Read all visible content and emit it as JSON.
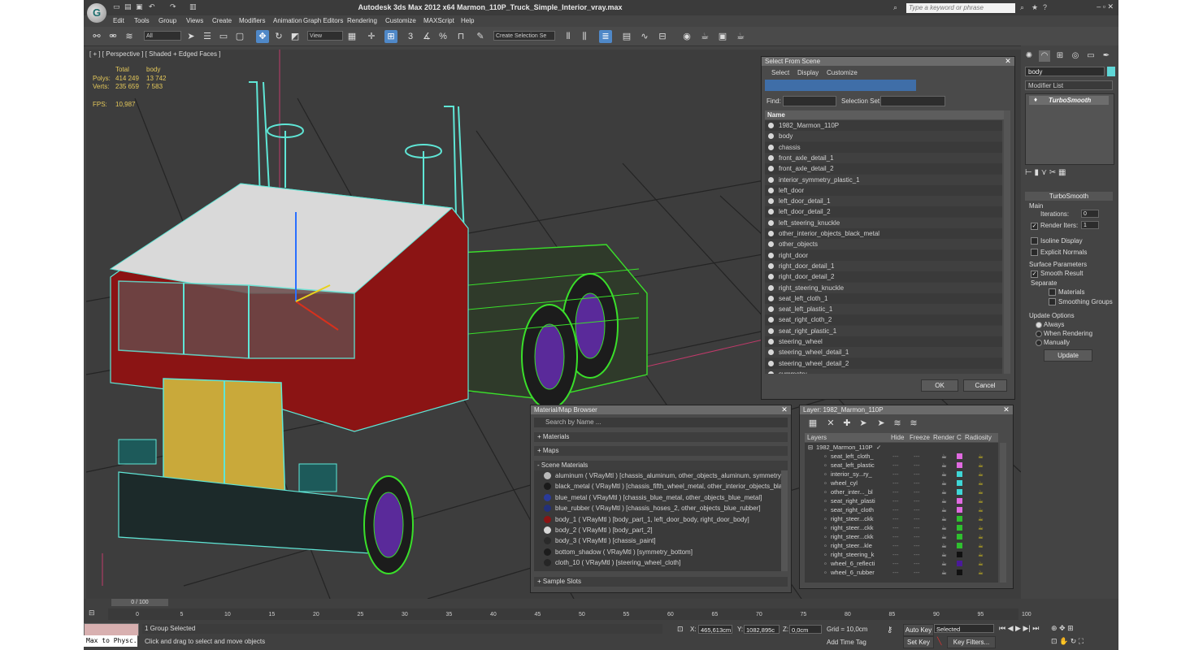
{
  "title_bar": {
    "app_title": "Autodesk 3ds Max  2012 x64     Marmon_110P_Truck_Simple_Interior_vray.max",
    "search_placeholder": "Type a keyword or phrase"
  },
  "menu": [
    "Edit",
    "Tools",
    "Group",
    "Views",
    "Create",
    "Modifiers",
    "Animation",
    "Graph Editors",
    "Rendering",
    "Customize",
    "MAXScript",
    "Help"
  ],
  "toolbar": {
    "selection_filter": "All",
    "ref_coord": "View",
    "named_selection": "Create Selection Se"
  },
  "viewport": {
    "label": "[ + ] [ Perspective ] [ Shaded + Edged Faces ]",
    "stats_header": [
      "Total",
      "body"
    ],
    "polys_label": "Polys:",
    "polys_total": "414 249",
    "polys_body": "13 742",
    "verts_label": "Verts:",
    "verts_total": "235 659",
    "verts_body": "7 583",
    "fps_label": "FPS:",
    "fps_value": "10,987"
  },
  "command_panel": {
    "object_name": "body",
    "modifier_list": "Modifier List",
    "stack_item": "TurboSmooth",
    "rollout_title": "TurboSmooth",
    "main_label": "Main",
    "iterations_label": "Iterations:",
    "iterations_value": "0",
    "render_iters_label": "Render Iters:",
    "render_iters_value": "1",
    "isoline_label": "Isoline Display",
    "explicit_normals_label": "Explicit Normals",
    "surface_params_label": "Surface Parameters",
    "smooth_result_label": "Smooth Result",
    "separate_label": "Separate",
    "materials_label": "Materials",
    "smoothing_groups_label": "Smoothing Groups",
    "update_options_label": "Update Options",
    "always_label": "Always",
    "when_rendering_label": "When Rendering",
    "manually_label": "Manually",
    "update_button": "Update"
  },
  "select_from_scene": {
    "title": "Select From Scene",
    "tabs": [
      "Select",
      "Display",
      "Customize"
    ],
    "find_label": "Find:",
    "selection_set_label": "Selection Set:",
    "column_name": "Name",
    "objects": [
      "1982_Marmon_110P",
      "body",
      "chassis",
      "front_axle_detail_1",
      "front_axle_detail_2",
      "interior_symmetry_plastic_1",
      "left_door",
      "left_door_detail_1",
      "left_door_detail_2",
      "left_steering_knuckle",
      "other_interior_objects_black_metal",
      "other_objects",
      "right_door",
      "right_door_detail_1",
      "right_door_detail_2",
      "right_steering_knuckle",
      "seat_left_cloth_1",
      "seat_left_plastic_1",
      "seat_right_cloth_2",
      "seat_right_plastic_1",
      "steering_wheel",
      "steering_wheel_detail_1",
      "steering_wheel_detail_2",
      "symmetry"
    ],
    "ok_button": "OK",
    "cancel_button": "Cancel"
  },
  "material_browser": {
    "title": "Material/Map Browser",
    "search_placeholder": "Search by Name ...",
    "groups": [
      "+ Materials",
      "+ Maps",
      "- Scene Materials"
    ],
    "materials": [
      {
        "text": "aluminum  ( VRayMtl )  [chassis_aluminum, other_objects_aluminum, symmetry_...",
        "ball": "#b9b9b9"
      },
      {
        "text": "black_metal  ( VRayMtl )  [chassis_fifth_wheel_metal, other_interior_objects_blac...",
        "ball": "#1a1a1a"
      },
      {
        "text": "blue_metal  ( VRayMtl )  [chassis_blue_metal, other_objects_blue_metal]",
        "ball": "#2a3a9a"
      },
      {
        "text": "blue_rubber  ( VRayMtl )  [chassis_hoses_2, other_objects_blue_rubber]",
        "ball": "#23307a"
      },
      {
        "text": "body_1  ( VRayMtl )  [body_part_1, left_door_body, right_door_body]",
        "ball": "#8a1414"
      },
      {
        "text": "body_2  ( VRayMtl )  [body_part_2]",
        "ball": "#d8d8d8"
      },
      {
        "text": "body_3  ( VRayMtl )  [chassis_paint]",
        "ball": "#2a2a2a"
      },
      {
        "text": "bottom_shadow  ( VRayMtl )  [symmetry_bottom]",
        "ball": "#1c1c1c"
      },
      {
        "text": "cloth_10  ( VRayMtl )  [steering_wheel_cloth]",
        "ball": "#262626"
      }
    ],
    "sample_slots": "+ Sample Slots"
  },
  "layer_manager": {
    "title": "Layer: 1982_Marmon_110P",
    "columns": [
      "Layers",
      "Hide",
      "Freeze",
      "Render",
      "C",
      "Radiosity"
    ],
    "root": "1982_Marmon_110P",
    "layers": [
      {
        "name": "seat_left_cloth_",
        "color": "#e06ae0"
      },
      {
        "name": "seat_left_plastic",
        "color": "#e06ae0"
      },
      {
        "name": "interior_sy...ry_",
        "color": "#3fd6d6"
      },
      {
        "name": "wheel_cyl",
        "color": "#3fd6d6"
      },
      {
        "name": "other_inter..._bl",
        "color": "#3fd6d6"
      },
      {
        "name": "seat_right_plasti",
        "color": "#e06ae0"
      },
      {
        "name": "seat_right_cloth",
        "color": "#e06ae0"
      },
      {
        "name": "right_steer...ckk",
        "color": "#2fbf2f"
      },
      {
        "name": "right_steer...ckk",
        "color": "#2fbf2f"
      },
      {
        "name": "right_steer...ckk",
        "color": "#2fbf2f"
      },
      {
        "name": "right_steer...kle",
        "color": "#2fbf2f"
      },
      {
        "name": "right_steering_k",
        "color": "#111111"
      },
      {
        "name": "wheel_6_reflecti",
        "color": "#4a1a9a"
      },
      {
        "name": "wheel_6_rubber",
        "color": "#111111"
      }
    ]
  },
  "timeline": {
    "frame_label": "0 / 100",
    "ticks": [
      "0",
      "5",
      "10",
      "15",
      "20",
      "25",
      "30",
      "35",
      "40",
      "45",
      "50",
      "55",
      "60",
      "65",
      "70",
      "75",
      "80",
      "85",
      "90",
      "95",
      "100"
    ]
  },
  "status": {
    "selection": "1 Group Selected",
    "prompt": "Click and drag to select and move objects",
    "maxscript": "Max to Physc.",
    "x_label": "X:",
    "x_value": "465,613cm",
    "y_label": "Y:",
    "y_value": "1082,895c",
    "z_label": "Z:",
    "z_value": "0,0cm",
    "grid": "Grid = 10,0cm",
    "add_time_tag": "Add Time Tag",
    "auto_key": "Auto Key",
    "set_key": "Set Key",
    "selected_combo": "Selected",
    "key_filters": "Key Filters..."
  }
}
